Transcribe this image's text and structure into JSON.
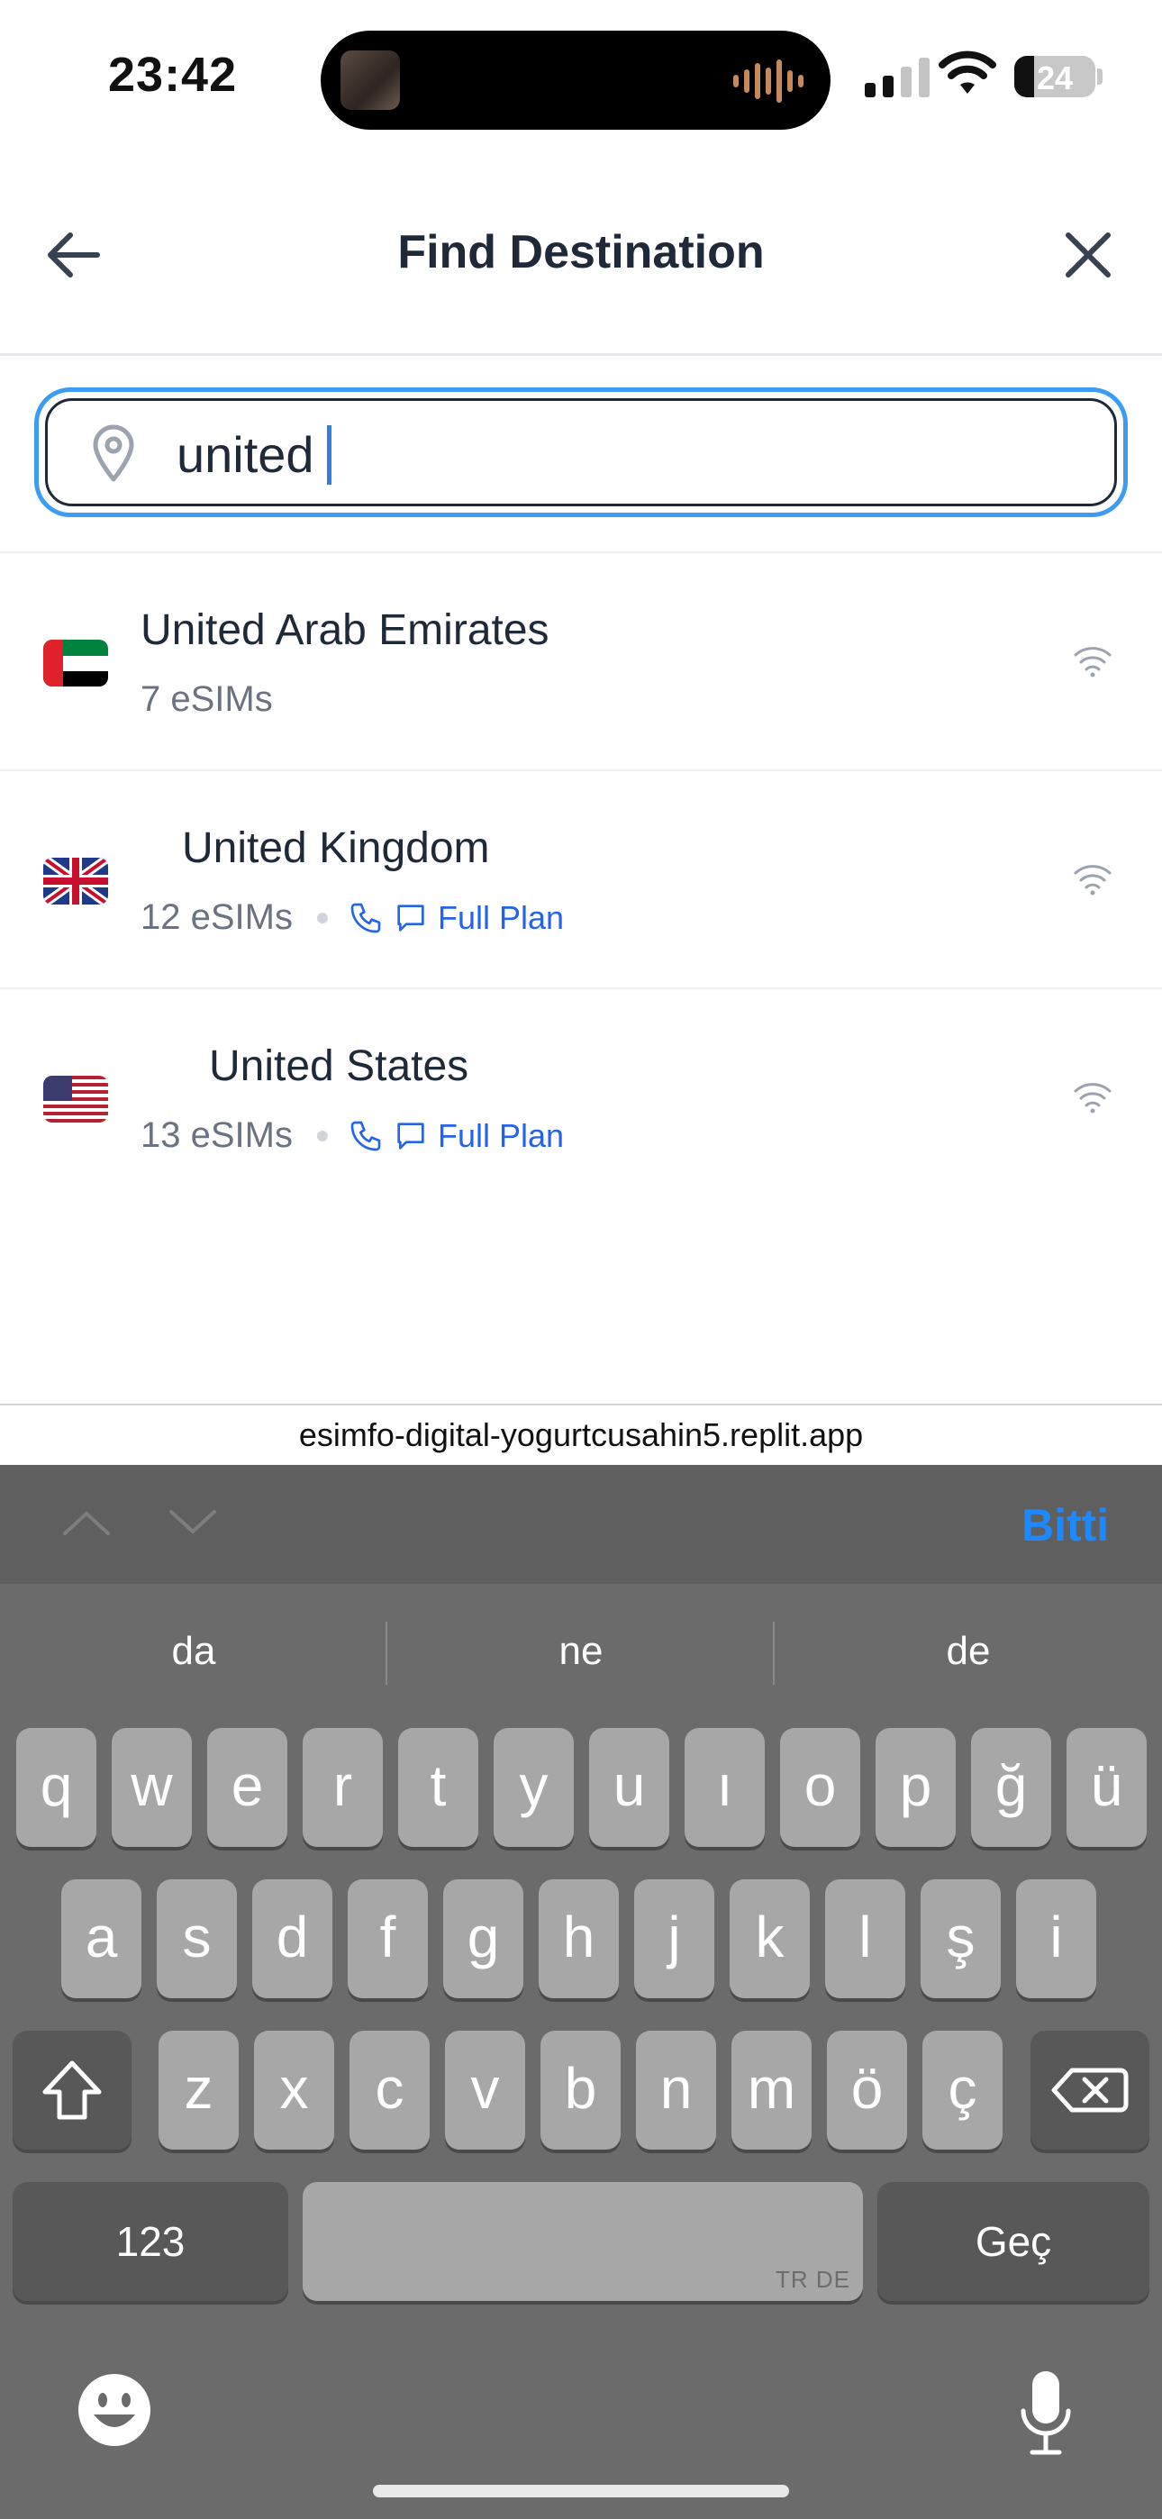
{
  "status_bar": {
    "time": "23:42",
    "battery": "24"
  },
  "header": {
    "title": "Find Destination"
  },
  "search": {
    "value": "united"
  },
  "results": [
    {
      "country": "United Arab Emirates",
      "count": "7 eSIMs",
      "feature": ""
    },
    {
      "country": "United Kingdom",
      "count": "12 eSIMs",
      "feature": "Full Plan"
    },
    {
      "country": "United States",
      "count": "13 eSIMs",
      "feature": "Full Plan"
    }
  ],
  "url_bar": {
    "url": "esimfo-digital-yogurtcusahin5.replit.app"
  },
  "keyboard": {
    "done_label": "Bitti",
    "suggestions": [
      "da",
      "ne",
      "de"
    ],
    "row1": [
      "q",
      "w",
      "e",
      "r",
      "t",
      "y",
      "u",
      "ı",
      "o",
      "p",
      "ğ",
      "ü"
    ],
    "row2": [
      "a",
      "s",
      "d",
      "f",
      "g",
      "h",
      "j",
      "k",
      "l",
      "ş",
      "i"
    ],
    "row3": [
      "z",
      "x",
      "c",
      "v",
      "b",
      "n",
      "m",
      "ö",
      "ç"
    ],
    "numbers_label": "123",
    "space_tag": "TR DE",
    "return_label": "Geç"
  },
  "colors": {
    "accent": "#2563eb",
    "focus_ring": "#3b9bf5",
    "keyboard_done": "#1e88ff"
  }
}
